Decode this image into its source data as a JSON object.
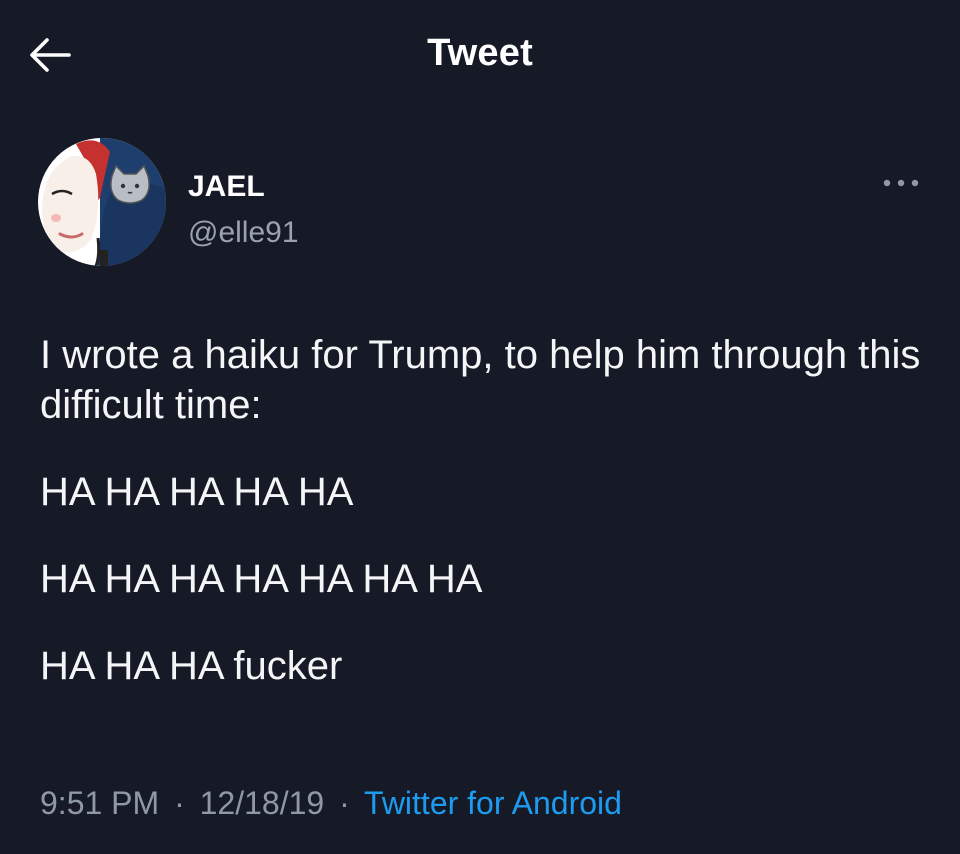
{
  "header": {
    "title": "Tweet",
    "back_icon": "arrow-left-icon"
  },
  "author": {
    "display_name": "JAEL",
    "handle": "@elle91",
    "avatar_icon": "avatar-illustration",
    "more_icon": "more-horizontal-icon"
  },
  "tweet": {
    "intro": "I wrote a haiku for Trump, to help him through this difficult time:",
    "haiku": [
      "HA HA HA HA HA",
      "HA HA HA HA HA HA HA",
      "HA HA HA fucker"
    ]
  },
  "meta": {
    "time": "9:51 PM",
    "date": "12/18/19",
    "separator": "·",
    "source": "Twitter for Android"
  },
  "colors": {
    "background": "#161a26",
    "text": "#f4f5f7",
    "muted": "#8f99a5",
    "link": "#1d9bf0"
  }
}
